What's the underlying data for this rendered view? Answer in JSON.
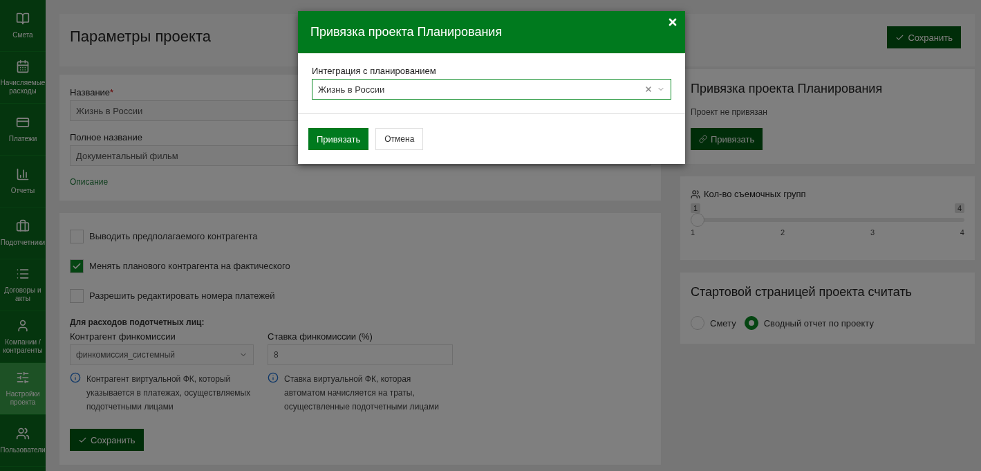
{
  "sidebar": {
    "items": [
      {
        "label": "Смета",
        "selected": false
      },
      {
        "label": "Начисляемые расходы",
        "selected": false
      },
      {
        "label": "Платежи",
        "selected": false
      },
      {
        "label": "Отчеты",
        "selected": false
      },
      {
        "label": "Подотчетники",
        "selected": false
      },
      {
        "label": "Договоры и акты",
        "selected": false
      },
      {
        "label": "Компании / контрагенты",
        "selected": false
      },
      {
        "label": "Настройки проекта",
        "selected": true
      },
      {
        "label": "Пользователи",
        "selected": false
      }
    ]
  },
  "header": {
    "title": "Параметры проекта",
    "save_button": "Сохранить"
  },
  "main_form": {
    "name_label": "Название",
    "required_mark": "*",
    "name_value": "Жизнь в России",
    "full_name_label": "Полное название",
    "full_name_value": "Документальный фильм",
    "description_label": "Описание"
  },
  "options": [
    {
      "label": "Выводить предполагаемого контрагента",
      "checked": false
    },
    {
      "label": "Менять планового контрагента на фактического",
      "checked": true
    },
    {
      "label": "Разрешить редактировать номера платежей",
      "checked": false
    }
  ],
  "commission": {
    "heading": "Для расходов подотчетных лиц:",
    "counterparty": {
      "label": "Контрагент финкомиссии",
      "value": "финкомиссия_системный",
      "hint": "Контрагент виртуальной ФК, который указывается в платежах, осуществляемых подотчетными лицами"
    },
    "rate": {
      "label": "Ставка финкомиссии (%)",
      "value": "8",
      "hint": "Ставка виртуальной ФК, которая автоматом начисляется на траты, осуществленные подотчетными лицами"
    },
    "save_button": "Сохранить"
  },
  "planning": {
    "title": "Привязка проекта Планирования",
    "status": "Проект не привязан",
    "button": "Привязать"
  },
  "crews": {
    "label": "Кол-во съемочных групп",
    "min_label": "1",
    "max_label": "4",
    "level": 0,
    "ticks": [
      "1",
      "2",
      "3",
      "4"
    ]
  },
  "start_page": {
    "title": "Стартовой страницей проекта считать",
    "options": [
      {
        "label": "Смету",
        "selected": false
      },
      {
        "label": "Сводный отчет по проекту",
        "selected": true
      }
    ]
  },
  "modal": {
    "title": "Привязка проекта Планирования",
    "field_label": "Интеграция с планированием",
    "field_value": "Жизнь в России",
    "confirm": "Привязать",
    "cancel": "Отмена"
  }
}
